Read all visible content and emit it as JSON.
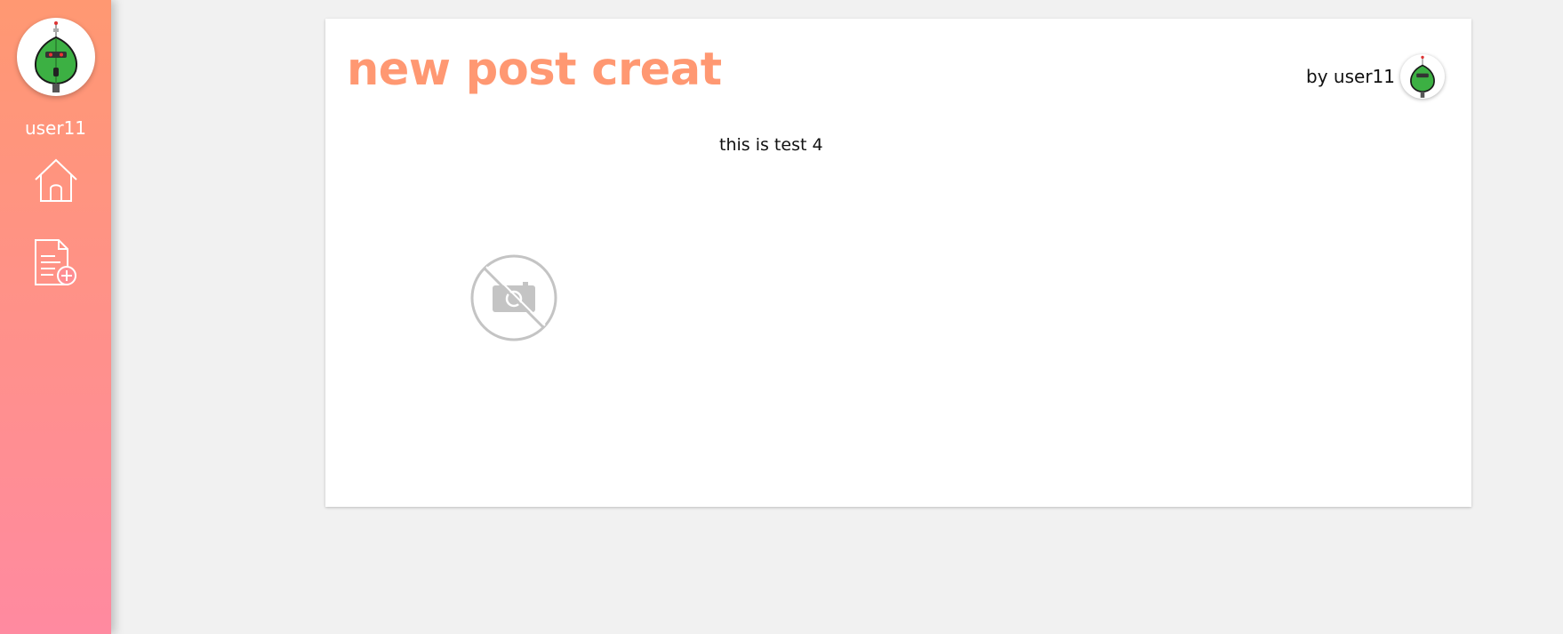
{
  "sidebar": {
    "username": "user11",
    "avatar_icon": "user-avatar-robot-leaf",
    "nav": [
      {
        "icon": "home-icon"
      },
      {
        "icon": "new-document-icon"
      }
    ]
  },
  "post": {
    "title": "new post creat",
    "author_label": "by user11",
    "body": "this is test 4",
    "image_placeholder_icon": "no-image-camera-icon"
  },
  "colors": {
    "sidebar_top": "#ff9872",
    "sidebar_bottom": "#ff8aa0",
    "title": "#ff9872",
    "page_background": "#f1f1f1",
    "placeholder_gray": "#c4c4c4"
  }
}
